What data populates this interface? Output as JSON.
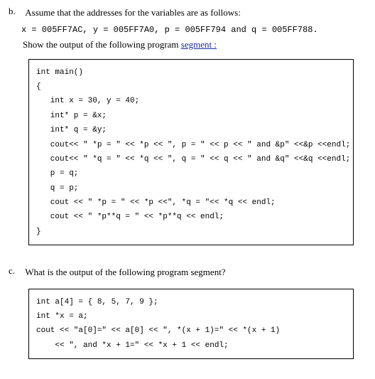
{
  "b": {
    "label": "b.",
    "intro": "Assume that the addresses for the variables are as follows:",
    "addresses": "x = 005FF7AC, y = 005FF7A0, p = 005FF794 and q = 005FF788.",
    "prompt_prefix": "Show the output of the following program ",
    "prompt_link": "segment :",
    "code": "int main()\n{\n   int x = 30, y = 40;\n   int* p = &x;\n   int* q = &y;\n   cout<< \" *p = \" << *p << \", p = \" << p << \" and &p\" <<&p <<endl;\n   cout<< \" *q = \" << *q << \", q = \" << q << \" and &q\" <<&q <<endl;\n   p = q;\n   q = p;\n   cout << \" *p = \" << *p <<\", *q = \"<< *q << endl;\n   cout << \" *p**q = \" << *p**q << endl;\n}"
  },
  "c": {
    "label": "c.",
    "prompt": "What is the output of the following program segment?",
    "code": "int a[4] = { 8, 5, 7, 9 };\nint *x = a;\ncout << \"a[0]=\" << a[0] << \", *(x + 1)=\" << *(x + 1)\n    << \", and *x + 1=\" << *x + 1 << endl;"
  }
}
